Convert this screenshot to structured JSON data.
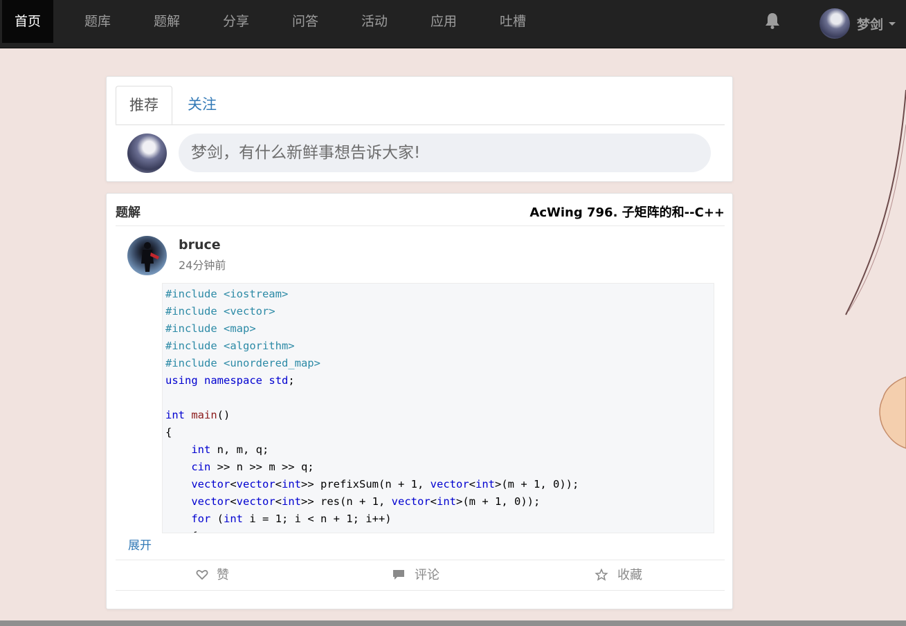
{
  "nav": {
    "items": [
      "首页",
      "题库",
      "题解",
      "分享",
      "问答",
      "活动",
      "应用",
      "吐槽"
    ],
    "active_index": 0,
    "username": "梦剑"
  },
  "composer": {
    "tabs": [
      "推荐",
      "关注"
    ],
    "active_tab": 0,
    "placeholder": "梦剑，有什么新鲜事想告诉大家!"
  },
  "post": {
    "category": "题解",
    "title": "AcWing 796. 子矩阵的和--C++",
    "author": "bruce",
    "time": "24分钟前",
    "expand_label": "展开",
    "code_lines": [
      "#include <iostream>",
      "#include <vector>",
      "#include <map>",
      "#include <algorithm>",
      "#include <unordered_map>",
      "using namespace std;",
      "",
      "int main()",
      "{",
      "    int n, m, q;",
      "    cin >> n >> m >> q;",
      "    vector<vector<int>> prefixSum(n + 1, vector<int>(m + 1, 0));",
      "    vector<vector<int>> res(n + 1, vector<int>(m + 1, 0));",
      "    for (int i = 1; i < n + 1; i++)",
      "    {"
    ],
    "actions": {
      "like": "赞",
      "comment": "评论",
      "favorite": "收藏"
    }
  },
  "icons": {
    "bell": "bell-icon",
    "like": "heart-icon",
    "comment": "comment-icon",
    "favorite": "star-icon"
  },
  "colors": {
    "nav_bg": "#222222",
    "page_bg": "#f1e3df",
    "link": "#337ab7"
  }
}
